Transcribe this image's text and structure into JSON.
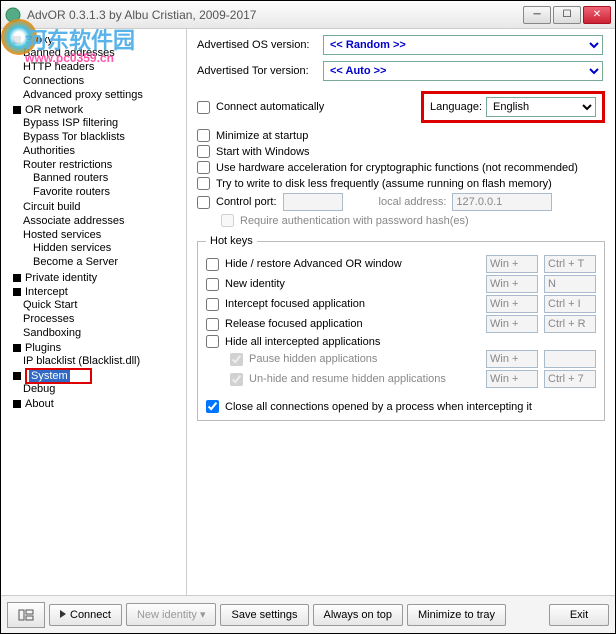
{
  "window": {
    "title": "AdvOR  0.3.1.3 by Albu Cristian, 2009-2017",
    "min": "─",
    "max": "☐",
    "close": "✕"
  },
  "watermark": {
    "line1": "河东软件园",
    "line2": "www.pc0359.cn"
  },
  "tree": {
    "proxy": "Proxy",
    "banned": "Banned addresses",
    "http": "HTTP headers",
    "conn": "Connections",
    "advproxy": "Advanced proxy settings",
    "ornet": "OR network",
    "bypassisp": "Bypass ISP filtering",
    "bypasstor": "Bypass Tor blacklists",
    "auth": "Authorities",
    "router": "Router restrictions",
    "bannedr": "Banned routers",
    "favr": "Favorite routers",
    "circuit": "Circuit build",
    "assoc": "Associate addresses",
    "hosted": "Hosted services",
    "hidden": "Hidden services",
    "become": "Become a Server",
    "private": "Private identity",
    "intercept": "Intercept",
    "quick": "Quick Start",
    "proc": "Processes",
    "sandbox": "Sandboxing",
    "plugins": "Plugins",
    "ipbl": "IP blacklist (Blacklist.dll)",
    "system": "System",
    "debug": "Debug",
    "about": "About"
  },
  "labels": {
    "advOS": "Advertised OS version:",
    "advTor": "Advertised Tor version:",
    "random": "<< Random >>",
    "auto": "<< Auto >>",
    "connectauto": "Connect automatically",
    "language": "Language:",
    "lang_val": "English",
    "minstart": "Minimize at startup",
    "startwin": "Start with Windows",
    "hwaccel": "Use hardware acceleration for cryptographic functions (not recommended)",
    "flashwrite": "Try to write to disk less frequently (assume running on flash memory)",
    "ctrlport": "Control port:",
    "localaddr": "local address:",
    "localaddr_val": "127.0.0.1",
    "reqauth": "Require authentication with password hash(es)"
  },
  "hotkeys": {
    "legend": "Hot keys",
    "hide": "Hide / restore Advanced OR window",
    "newid": "New identity",
    "intf": "Intercept focused application",
    "relf": "Release focused application",
    "hideall": "Hide all intercepted applications",
    "pause": "Pause hidden applications",
    "unhide": "Un-hide and resume hidden applications",
    "winplus": "Win +",
    "k_ctrlT": "Ctrl + T",
    "k_N": "N",
    "k_ctrlI": "Ctrl + I",
    "k_ctrlR": "Ctrl + R",
    "k_ctrl7": "Ctrl + 7"
  },
  "closeall": "Close all connections opened by a process when intercepting it",
  "bottom": {
    "connect": "Connect",
    "newid": "New identity",
    "save": "Save settings",
    "ontop": "Always on top",
    "mintray": "Minimize to tray",
    "exit": "Exit"
  }
}
